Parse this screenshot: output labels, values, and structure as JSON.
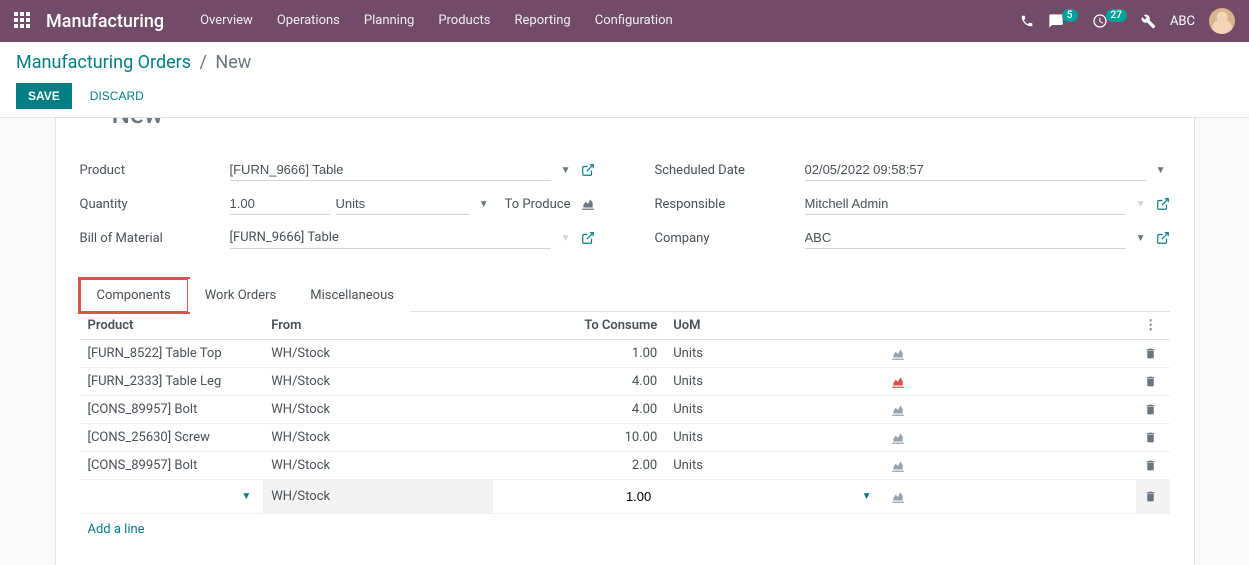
{
  "brand": "Manufacturing",
  "nav": {
    "items": [
      "Overview",
      "Operations",
      "Planning",
      "Products",
      "Reporting",
      "Configuration"
    ],
    "chat_badge": "5",
    "activity_badge": "27",
    "user": "ABC"
  },
  "breadcrumb": {
    "root": "Manufacturing Orders",
    "current": "New"
  },
  "buttons": {
    "save": "Save",
    "discard": "Discard"
  },
  "form": {
    "product": {
      "label": "Product",
      "value": "[FURN_9666] Table"
    },
    "quantity": {
      "label": "Quantity",
      "value": "1.00",
      "uom": "Units",
      "to_produce": "To Produce"
    },
    "bom": {
      "label": "Bill of Material",
      "value": "[FURN_9666] Table"
    },
    "scheduled": {
      "label": "Scheduled Date",
      "value": "02/05/2022 09:58:57"
    },
    "responsible": {
      "label": "Responsible",
      "value": "Mitchell Admin"
    },
    "company": {
      "label": "Company",
      "value": "ABC"
    }
  },
  "tabs": {
    "components": "Components",
    "work_orders": "Work Orders",
    "misc": "Miscellaneous"
  },
  "table": {
    "headers": {
      "product": "Product",
      "from": "From",
      "to_consume": "To Consume",
      "uom": "UoM"
    },
    "rows": [
      {
        "product": "[FURN_8522] Table Top",
        "from": "WH/Stock",
        "to_consume": "1.00",
        "uom": "Units",
        "forecast": "ok"
      },
      {
        "product": "[FURN_2333] Table Leg",
        "from": "WH/Stock",
        "to_consume": "4.00",
        "uom": "Units",
        "forecast": "bad"
      },
      {
        "product": "[CONS_89957] Bolt",
        "from": "WH/Stock",
        "to_consume": "4.00",
        "uom": "Units",
        "forecast": "ok"
      },
      {
        "product": "[CONS_25630] Screw",
        "from": "WH/Stock",
        "to_consume": "10.00",
        "uom": "Units",
        "forecast": "ok"
      },
      {
        "product": "[CONS_89957] Bolt",
        "from": "WH/Stock",
        "to_consume": "2.00",
        "uom": "Units",
        "forecast": "ok"
      }
    ],
    "edit_row": {
      "from": "WH/Stock",
      "to_consume": "1.00"
    },
    "add_line": "Add a line"
  }
}
